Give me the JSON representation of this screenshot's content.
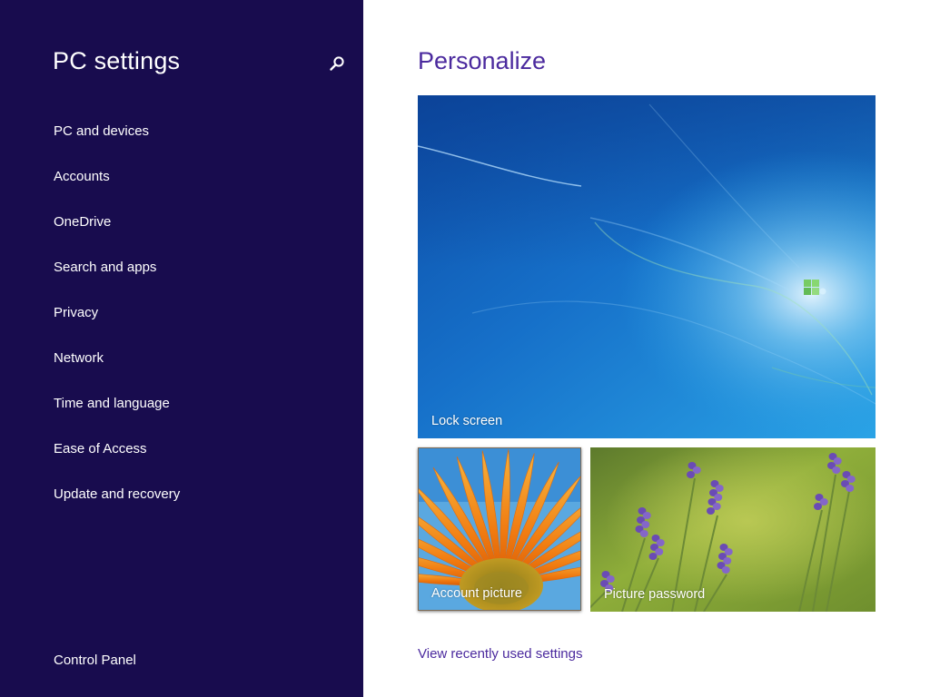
{
  "sidebar": {
    "title": "PC settings",
    "search_icon": "search-icon",
    "items": [
      {
        "label": "PC and devices"
      },
      {
        "label": "Accounts"
      },
      {
        "label": "OneDrive"
      },
      {
        "label": "Search and apps"
      },
      {
        "label": "Privacy"
      },
      {
        "label": "Network"
      },
      {
        "label": "Time and language"
      },
      {
        "label": "Ease of Access"
      },
      {
        "label": "Update and recovery"
      }
    ],
    "footer_link": "Control Panel"
  },
  "main": {
    "title": "Personalize",
    "tiles": {
      "lock_screen": "Lock screen",
      "account_picture": "Account picture",
      "picture_password": "Picture password"
    },
    "recent_link": "View recently used settings"
  },
  "colors": {
    "sidebar_bg": "#180c4e",
    "accent": "#4b2a9e",
    "page_bg": "#ffffff"
  }
}
